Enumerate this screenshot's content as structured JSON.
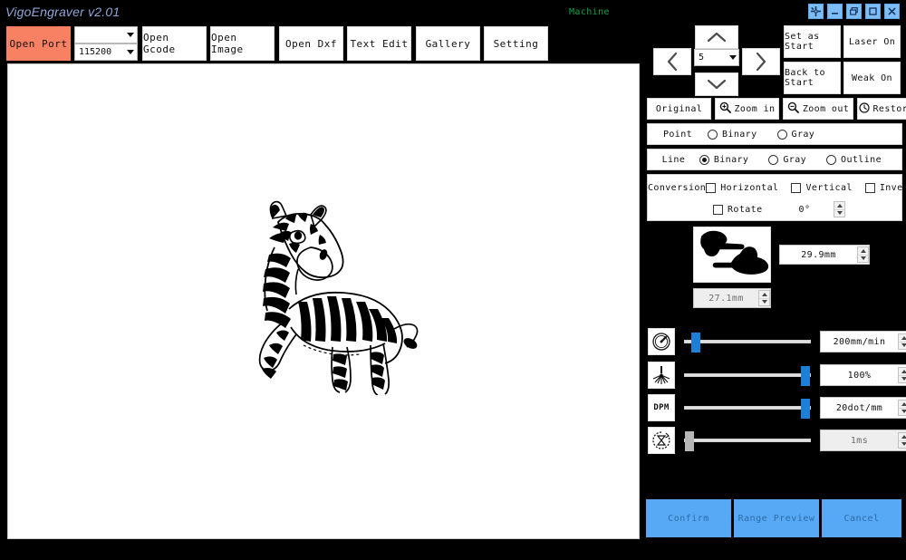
{
  "titlebar": {
    "app_title": "VigoEngraver v2.01",
    "machine_label": "Machine",
    "window_buttons": [
      {
        "name": "settings-gear",
        "icon": "gear-icon"
      },
      {
        "name": "minimize",
        "icon": "minimize-icon"
      },
      {
        "name": "restore",
        "icon": "restore-icon"
      },
      {
        "name": "maximize",
        "icon": "maximize-icon"
      },
      {
        "name": "close",
        "icon": "close-icon"
      }
    ]
  },
  "toolbar": {
    "open_port": "Open Port",
    "port_combo_value": "",
    "baud_combo_value": "115200",
    "open_gcode": "Open Gcode",
    "open_image": "Open Image",
    "open_dxf": "Open Dxf",
    "text_edit": "Text Edit",
    "gallery": "Gallery",
    "setting": "Setting"
  },
  "jog": {
    "step_value": "5",
    "up": "up-arrow",
    "down": "down-arrow",
    "left": "left-arrow",
    "right": "right-arrow"
  },
  "machine_buttons": {
    "set_as_start": "Set as Start",
    "laser_on": "Laser On",
    "back_to_start": "Back to Start",
    "weak_on": "Weak On"
  },
  "view": {
    "original": "Original",
    "zoom_in": "Zoom in",
    "zoom_out": "Zoom out",
    "restore": "Restore"
  },
  "point_row": {
    "label": "Point",
    "options": [
      {
        "label": "Binary",
        "selected": false
      },
      {
        "label": "Gray",
        "selected": false
      }
    ]
  },
  "line_row": {
    "label": "Line",
    "options": [
      {
        "label": "Binary",
        "selected": true
      },
      {
        "label": "Gray",
        "selected": false
      },
      {
        "label": "Outline",
        "selected": false
      }
    ]
  },
  "conversion": {
    "label": "Conversion",
    "horizontal": "Horizontal",
    "vertical": "Vertical",
    "inverse": "Inverse",
    "rotate": "Rotate",
    "rotate_value": "0°",
    "horizontal_checked": false,
    "vertical_checked": false,
    "inverse_checked": false,
    "rotate_checked": false
  },
  "size": {
    "height_value": "29.9mm",
    "width_value": "27.1mm"
  },
  "sliders": [
    {
      "icon": "speed-gauge-icon",
      "value": "200mm/min",
      "percent": 5,
      "disabled": false
    },
    {
      "icon": "laser-power-icon",
      "value": "100%",
      "percent": 97,
      "disabled": false
    },
    {
      "icon": "dpm-icon",
      "icon_text": "DPM",
      "value": "20dot/mm",
      "percent": 97,
      "disabled": false
    },
    {
      "icon": "timer-icon",
      "value": "1ms",
      "percent": 0,
      "disabled": true
    }
  ],
  "bottom_buttons": {
    "confirm": "Confirm",
    "range_preview": "Range Preview",
    "cancel": "Cancel"
  },
  "colors": {
    "accent_blue": "#57a9f5",
    "slider_blue": "#1e7fd6",
    "open_port_salmon": "#f98163",
    "machine_green": "#11a24a",
    "title_blue": "#8fa6d8",
    "background": "#000000"
  }
}
